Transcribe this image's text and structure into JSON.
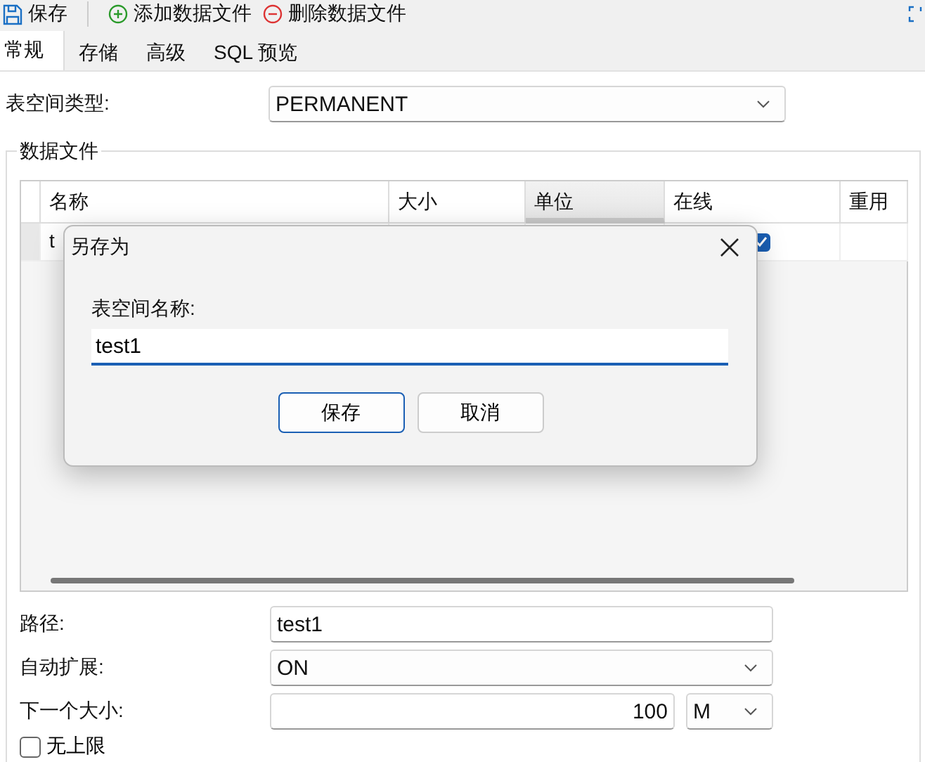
{
  "toolbar": {
    "buttons": [
      {
        "kind": "save",
        "label": "保存"
      },
      {
        "kind": "add",
        "label": "添加数据文件"
      },
      {
        "kind": "remove",
        "label": "删除数据文件"
      }
    ]
  },
  "tabs": [
    {
      "label": "常规",
      "selected": true
    },
    {
      "label": "存储",
      "selected": false
    },
    {
      "label": "高级",
      "selected": false
    },
    {
      "label": "SQL 预览",
      "selected": false
    }
  ],
  "tablespace_type": {
    "label": "表空间类型:",
    "value": "PERMANENT"
  },
  "data_files": {
    "title": "数据文件",
    "columns": [
      {
        "label": "名称",
        "selected": false
      },
      {
        "label": "大小",
        "selected": false
      },
      {
        "label": "单位",
        "selected": true
      },
      {
        "label": "在线",
        "selected": false
      },
      {
        "label": "重用",
        "selected": false
      }
    ],
    "rows": [
      {
        "name": "t",
        "online": true
      }
    ]
  },
  "path": {
    "label": "路径:",
    "value": "test1"
  },
  "autoextend": {
    "label": "自动扩展:",
    "value": "ON"
  },
  "next_size": {
    "label": "下一个大小:",
    "value": "100",
    "unit": "M"
  },
  "unlimited": {
    "label": "无上限",
    "checked": false
  },
  "dialog": {
    "title": "另存为",
    "field_label": "表空间名称:",
    "value": "test1",
    "buttons": [
      {
        "label": "保存",
        "default": true
      },
      {
        "label": "取消",
        "default": false
      }
    ]
  }
}
